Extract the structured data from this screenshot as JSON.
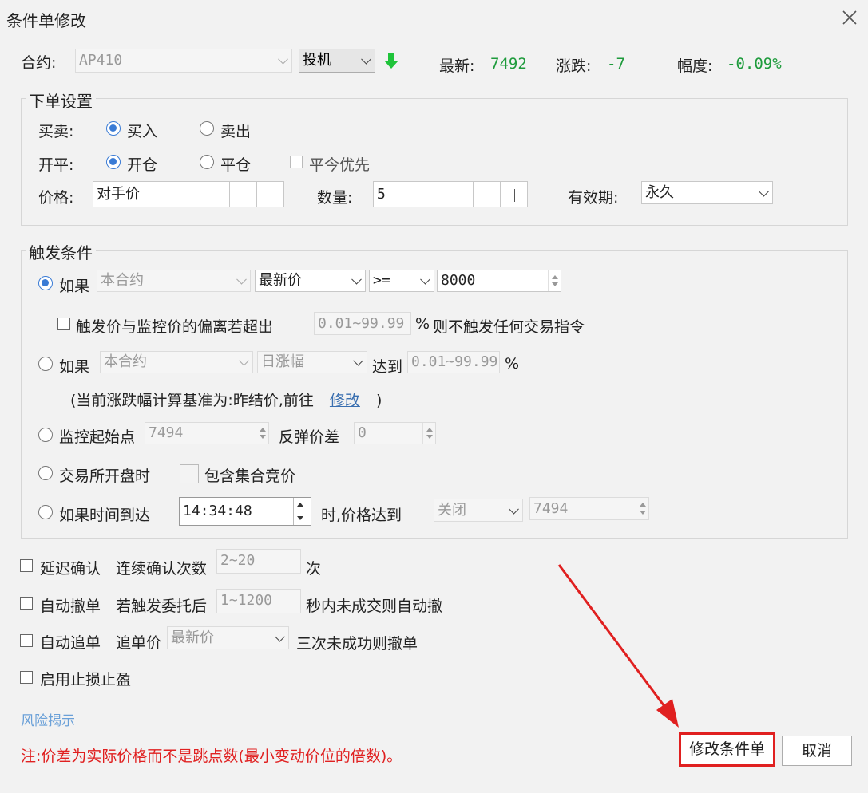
{
  "window": {
    "title": "条件单修改"
  },
  "contract": {
    "label": "合约:",
    "value": "AP410",
    "hedge_type": "投机",
    "latest_label": "最新:",
    "latest_value": "7492",
    "change_label": "涨跌:",
    "change_value": "-7",
    "amplitude_label": "幅度:",
    "amplitude_value": "-0.09%"
  },
  "order_settings": {
    "legend": "下单设置",
    "direction_label": "买卖:",
    "buy": "买入",
    "sell": "卖出",
    "offset_label": "开平:",
    "open": "开仓",
    "close": "平仓",
    "close_today_first": "平今优先",
    "price_label": "价格:",
    "price_value": "对手价",
    "qty_label": "数量:",
    "qty_value": "5",
    "validity_label": "有效期:",
    "validity_value": "永久"
  },
  "trigger": {
    "legend": "触发条件",
    "cond1_label": "如果",
    "cond1_contract": "本合约",
    "cond1_price_type": "最新价",
    "cond1_operator": ">=",
    "cond1_value": "8000",
    "deviation_text": "触发价与监控价的偏离若超出",
    "deviation_range": "0.01~99.99",
    "deviation_unit": "%",
    "deviation_suffix": "则不触发任何交易指令",
    "cond2_label": "如果",
    "cond2_contract": "本合约",
    "cond2_type": "日涨幅",
    "cond2_reach": "达到",
    "cond2_range": "0.01~99.99",
    "cond2_unit": "%",
    "basis_prefix": "(当前涨跌幅计算基准为:昨结价,前往",
    "basis_link": "修改",
    "basis_suffix": ")",
    "monitor_label": "监控起始点",
    "monitor_value": "7494",
    "rebound_label": "反弹价差",
    "rebound_value": "0",
    "exchange_open_label": "交易所开盘时",
    "include_auction": "包含集合竞价",
    "time_label": "如果时间到达",
    "time_value": "14:34:48",
    "time_suffix": "时,价格达到",
    "time_price_type": "关闭",
    "time_price_value": "7494"
  },
  "options": {
    "delay_label": "延迟确认",
    "delay_text": "连续确认次数",
    "delay_range": "2~20",
    "delay_unit": "次",
    "auto_cancel_label": "自动撤单",
    "auto_cancel_text": "若触发委托后",
    "auto_cancel_range": "1~1200",
    "auto_cancel_suffix": "秒内未成交则自动撤",
    "auto_chase_label": "自动追单",
    "auto_chase_text": "追单价",
    "auto_chase_value": "最新价",
    "auto_chase_suffix": "三次未成功则撤单",
    "stop_label": "启用止损止盈"
  },
  "footer": {
    "risk_link": "风险揭示",
    "note": "注:价差为实际价格而不是跳点数(最小变动价位的倍数)。",
    "modify_button": "修改条件单",
    "cancel_button": "取消"
  },
  "colors": {
    "accent": "#3a7bd5",
    "positive": "#1e9b3c",
    "note": "#e02020",
    "highlight": "#e02020"
  }
}
